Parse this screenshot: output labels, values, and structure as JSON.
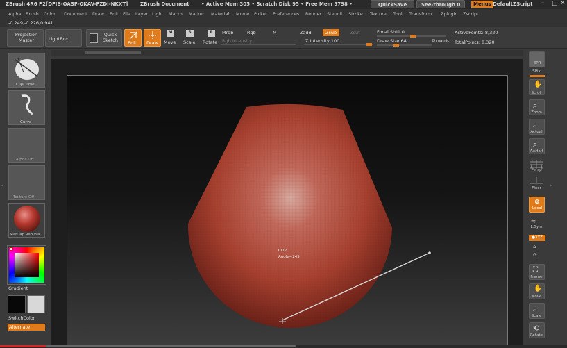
{
  "title_bar": {
    "app": "ZBrush 4R6 P2[DFIB-OASF-QKAV-FZDI-NKXT]",
    "document": "ZBrush Document",
    "mem": "• Active Mem 305 • Scratch Disk 95 • Free Mem 3798 •",
    "quicksave": "QuickSave",
    "see_through": "See-through 0",
    "menus": "Menus",
    "script": "DefaultZScript"
  },
  "menu_items": [
    "Alpha",
    "Brush",
    "Color",
    "Document",
    "Draw",
    "Edit",
    "File",
    "Layer",
    "Light",
    "Macro",
    "Marker",
    "Material",
    "Movie",
    "Picker",
    "Preferences",
    "Render",
    "Stencil",
    "Stroke",
    "Texture",
    "Tool",
    "Transform",
    "Zplugin",
    "Zscript"
  ],
  "coords": "-0.249,-0.226,0.941",
  "top_shelf": {
    "projection_master": "Projection Master",
    "lightbox": "LightBox",
    "quick_sketch": "Quick Sketch",
    "edit": "Edit",
    "draw": "Draw",
    "move": "Move",
    "scale": "Scale",
    "rotate": "Rotate",
    "mrgb": "Mrgb",
    "rgb": "Rgb",
    "m": "M",
    "zadd": "Zadd",
    "zsub": "Zsub",
    "zcut": "Zcut",
    "rgb_intensity": "Rgb Intensity",
    "z_intensity": "Z Intensity 100",
    "focal_shift": "Focal Shift 0",
    "draw_size": "Draw Size 64",
    "dynamic": "Dynamic",
    "active_points": "ActivePoints: 8,320",
    "total_points": "TotalPoints: 8,320"
  },
  "left_shelf": {
    "brush": "ClipCurve",
    "stroke": "Curve",
    "alpha": "Alpha Off",
    "texture": "Texture Off",
    "material": "MatCap Red Wa",
    "gradient": "Gradient",
    "switch_color": "SwitchColor",
    "alternate": "Alternate"
  },
  "right_shelf": {
    "bpr": "BPR",
    "spix": "SPix",
    "scroll": "Scroll",
    "zoom": "Zoom",
    "actual": "Actual",
    "aahalf": "AAHalf",
    "persp": "Persp",
    "floor": "Floor",
    "local": "Local",
    "lsym": "L.Sym",
    "xyz": "●XYZ",
    "frame": "Frame",
    "move": "Move",
    "scale": "Scale",
    "rotate": "Rotate"
  },
  "canvas": {
    "clip_label": "CLIP",
    "angle_label": "Angle=245"
  },
  "colors": {
    "accent": "#e07b1c",
    "mesh": "#b04a34"
  }
}
